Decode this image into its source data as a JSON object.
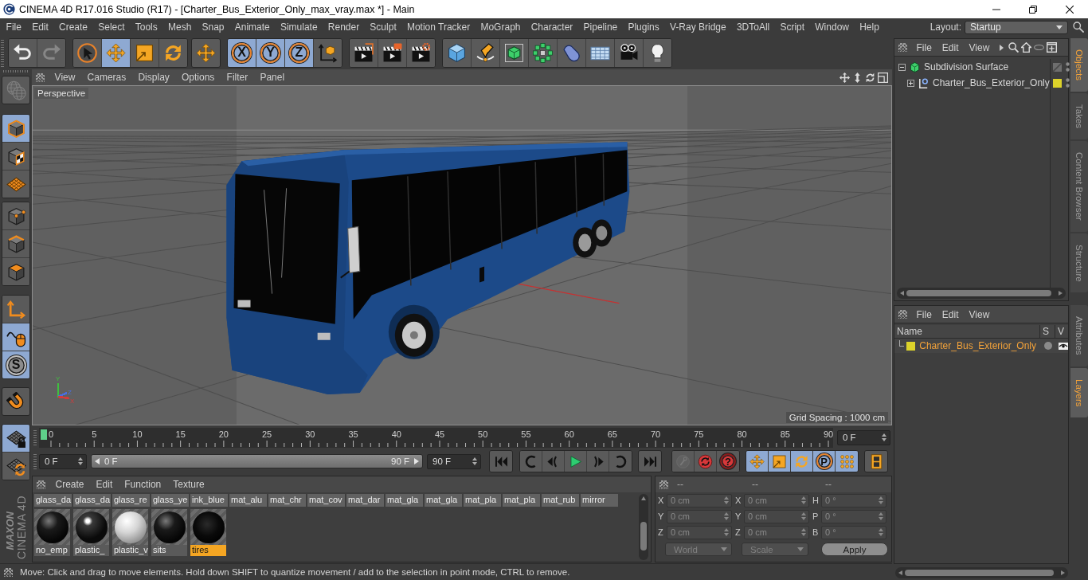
{
  "window": {
    "title": "CINEMA 4D R17.016 Studio (R17) - [Charter_Bus_Exterior_Only_max_vray.max *] - Main"
  },
  "menu_bar": [
    "File",
    "Edit",
    "Create",
    "Select",
    "Tools",
    "Mesh",
    "Snap",
    "Animate",
    "Simulate",
    "Render",
    "Sculpt",
    "Motion Tracker",
    "MoGraph",
    "Character",
    "Pipeline",
    "Plugins",
    "V-Ray Bridge",
    "3DToAll",
    "Script",
    "Window",
    "Help"
  ],
  "layout": {
    "label": "Layout:",
    "value": "Startup"
  },
  "toolbar": [
    [
      {
        "kind": "undo",
        "active": false,
        "disabled": false
      },
      {
        "kind": "redo",
        "active": false,
        "disabled": true
      }
    ],
    [
      {
        "kind": "select",
        "active": false,
        "disabled": false
      },
      {
        "kind": "move",
        "active": true,
        "disabled": false
      },
      {
        "kind": "scale",
        "active": false,
        "disabled": false
      },
      {
        "kind": "rotate",
        "active": false,
        "disabled": false
      }
    ],
    [
      {
        "kind": "recent",
        "active": false,
        "disabled": false
      }
    ],
    [
      {
        "kind": "axis",
        "label": "X",
        "active": true,
        "disabled": false
      },
      {
        "kind": "axis",
        "label": "Y",
        "active": true,
        "disabled": false
      },
      {
        "kind": "axis",
        "label": "Z",
        "active": true,
        "disabled": false
      },
      {
        "kind": "coordinates",
        "active": false,
        "disabled": false
      }
    ],
    [
      {
        "kind": "renderview",
        "active": false,
        "disabled": false
      },
      {
        "kind": "renderpicture",
        "active": false,
        "disabled": false
      },
      {
        "kind": "rendersettings",
        "active": false,
        "disabled": false
      }
    ],
    [
      {
        "kind": "cube",
        "active": false,
        "disabled": false
      },
      {
        "kind": "pen",
        "active": false,
        "disabled": false
      },
      {
        "kind": "subdivision",
        "active": false,
        "disabled": false
      },
      {
        "kind": "cloner",
        "active": false,
        "disabled": false
      },
      {
        "kind": "deformer",
        "active": false,
        "disabled": false
      },
      {
        "kind": "floor",
        "active": false,
        "disabled": false
      },
      {
        "kind": "camera",
        "active": false,
        "disabled": false
      },
      {
        "kind": "light",
        "active": false,
        "disabled": false
      }
    ]
  ],
  "modes": [
    [
      {
        "kind": "editable",
        "active": false,
        "disabled": true
      }
    ],
    [
      {
        "kind": "model",
        "active": true,
        "disabled": false
      },
      {
        "kind": "texture",
        "active": false,
        "disabled": false
      },
      {
        "kind": "workplane",
        "active": false,
        "disabled": false
      }
    ],
    [
      {
        "kind": "points",
        "active": false,
        "disabled": false
      },
      {
        "kind": "edges",
        "active": false,
        "disabled": false
      },
      {
        "kind": "polygons",
        "active": false,
        "disabled": false
      }
    ],
    [
      {
        "kind": "axes",
        "active": false,
        "disabled": false
      },
      {
        "kind": "tweak",
        "active": true,
        "disabled": false
      },
      {
        "kind": "solo",
        "label": "S",
        "active": true,
        "disabled": false
      }
    ],
    [
      {
        "kind": "snap",
        "active": false,
        "disabled": false
      }
    ],
    [
      {
        "kind": "lock",
        "active": true,
        "disabled": false
      },
      {
        "kind": "planar",
        "active": false,
        "disabled": false
      }
    ]
  ],
  "logo": {
    "brand": "MAXON",
    "product": "CINEMA 4D"
  },
  "viewport": {
    "menu": [
      "View",
      "Cameras",
      "Display",
      "Options",
      "Filter",
      "Panel"
    ],
    "camera": "Perspective",
    "grid_spacing": "Grid Spacing : 1000 cm",
    "axes": [
      {
        "label": "Y",
        "color": "#3fbf3f"
      },
      {
        "label": "Z",
        "color": "#4a6ee0"
      },
      {
        "label": "X",
        "color": "#d23c3c"
      }
    ]
  },
  "timeline": {
    "ticks": [
      "0",
      "5",
      "10",
      "15",
      "20",
      "25",
      "30",
      "35",
      "40",
      "45",
      "50",
      "55",
      "60",
      "65",
      "70",
      "75",
      "80",
      "85",
      "90"
    ],
    "playhead": {
      "level": 0
    },
    "current_frame": "0 F"
  },
  "playback": {
    "start": "0 F",
    "range": {
      "start": "0 F",
      "end": "90 F",
      "level": 1
    },
    "end": "90 F",
    "buttons": [
      [
        {
          "kind": "first",
          "active": false,
          "disabled": false
        }
      ],
      [
        {
          "kind": "prevkey",
          "active": false,
          "disabled": false
        },
        {
          "kind": "prevframe",
          "active": false,
          "disabled": false
        },
        {
          "kind": "play",
          "active": false,
          "disabled": false
        },
        {
          "kind": "nextframe",
          "active": false,
          "disabled": false
        },
        {
          "kind": "nextkey",
          "active": false,
          "disabled": false
        }
      ],
      [
        {
          "kind": "last",
          "active": false,
          "disabled": false
        }
      ],
      [
        {
          "kind": "record",
          "active": false,
          "disabled": true
        },
        {
          "kind": "autokey",
          "active": false,
          "disabled": false
        },
        {
          "kind": "keyselection",
          "label": "?",
          "active": false,
          "disabled": false
        }
      ],
      [
        {
          "kind": "keymove",
          "active": true,
          "disabled": false
        },
        {
          "kind": "keyscale",
          "active": true,
          "disabled": false
        },
        {
          "kind": "keyrotate",
          "active": true,
          "disabled": false
        },
        {
          "kind": "keyparam",
          "label": "P",
          "active": true,
          "disabled": false
        },
        {
          "kind": "keypoints",
          "active": true,
          "disabled": false
        }
      ],
      [
        {
          "kind": "timeline",
          "active": false,
          "disabled": false
        }
      ]
    ]
  },
  "materials": {
    "menu": [
      "Create",
      "Edit",
      "Function",
      "Texture"
    ],
    "rows": [
      [
        {
          "name": "glass_da",
          "selected": false
        },
        {
          "name": "glass_da",
          "selected": false
        },
        {
          "name": "glass_re",
          "selected": false
        },
        {
          "name": "glass_ye",
          "selected": false
        },
        {
          "name": "ink_blue",
          "selected": false
        },
        {
          "name": "mat_alu",
          "selected": false
        },
        {
          "name": "mat_chr",
          "selected": false
        },
        {
          "name": "mat_cov",
          "selected": false
        },
        {
          "name": "mat_dar",
          "selected": false
        },
        {
          "name": "mat_gla",
          "selected": false
        },
        {
          "name": "mat_gla",
          "selected": false
        },
        {
          "name": "mat_pla",
          "selected": false
        },
        {
          "name": "mat_pla",
          "selected": false
        },
        {
          "name": "mat_rub",
          "selected": false
        },
        {
          "name": "mirror",
          "selected": false
        }
      ],
      [
        {
          "name": "no_emp",
          "kind": "black",
          "selected": false
        },
        {
          "name": "plastic_",
          "kind": "glossy",
          "selected": false
        },
        {
          "name": "plastic_v",
          "kind": "white",
          "selected": false
        },
        {
          "name": "sits",
          "kind": "black",
          "selected": false
        },
        {
          "name": "tires",
          "kind": "dark",
          "selected": true
        }
      ]
    ]
  },
  "coordinates": {
    "headers": [
      "--",
      "--",
      "--"
    ],
    "rows": [
      [
        {
          "label": "X",
          "value": "0 cm",
          "disabled": true
        },
        {
          "label": "X",
          "value": "0 cm",
          "disabled": true
        },
        {
          "label": "H",
          "value": "0 °",
          "disabled": true
        }
      ],
      [
        {
          "label": "Y",
          "value": "0 cm",
          "disabled": true
        },
        {
          "label": "Y",
          "value": "0 cm",
          "disabled": true
        },
        {
          "label": "P",
          "value": "0 °",
          "disabled": true
        }
      ],
      [
        {
          "label": "Z",
          "value": "0 cm",
          "disabled": true
        },
        {
          "label": "Z",
          "value": "0 cm",
          "disabled": true
        },
        {
          "label": "B",
          "value": "0 °",
          "disabled": true
        }
      ]
    ],
    "dropdowns": [
      {
        "value": "World",
        "disabled": true
      },
      {
        "value": "Scale",
        "disabled": true
      }
    ],
    "apply": "Apply"
  },
  "status_bar": "Move: Click and drag to move elements. Hold down SHIFT to quantize movement / add to the selection in point mode, CTRL to remove.",
  "objects": {
    "menu": [
      "File",
      "Edit",
      "View"
    ],
    "tree": [
      {
        "name": "Subdivision Surface",
        "kind": "subdivision",
        "expanded": true,
        "enabled": true,
        "children": [
          {
            "name": "Charter_Bus_Exterior_Only",
            "kind": "null",
            "expanded": false,
            "color": "#dcd22a"
          }
        ]
      }
    ]
  },
  "side_tabs_top": [
    {
      "label": "Objects",
      "selected": true
    },
    {
      "label": "Takes",
      "selected": false
    },
    {
      "label": "Content Browser",
      "selected": false
    },
    {
      "label": "Structure",
      "selected": false
    }
  ],
  "layers": {
    "menu": [
      "File",
      "Edit",
      "View"
    ],
    "columns": [
      "Name",
      "S",
      "V"
    ],
    "rows": [
      {
        "name": "Charter_Bus_Exterior_Only",
        "color": "#dcd22a",
        "selected": true,
        "solo": false,
        "visible": true
      }
    ]
  },
  "side_tabs_bottom": [
    {
      "label": "Attributes",
      "selected": false
    },
    {
      "label": "Layers",
      "selected": true
    }
  ]
}
